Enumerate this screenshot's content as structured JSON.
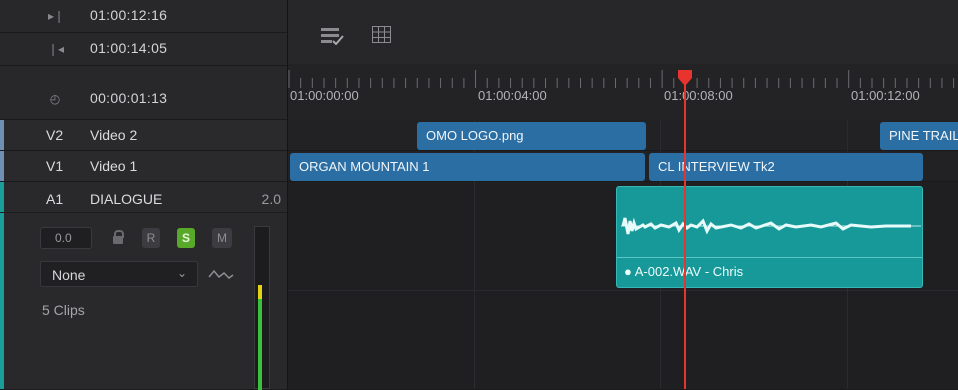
{
  "header": {
    "timecodes": [
      {
        "icon": "next-frame-icon",
        "glyph": "▸❘",
        "value": "01:00:12:16"
      },
      {
        "icon": "prev-frame-icon",
        "glyph": "❘◂",
        "value": "01:00:14:05"
      },
      {
        "icon": "clock-icon",
        "glyph": "◴",
        "value": "00:00:01:13"
      }
    ]
  },
  "tracks": {
    "v2": {
      "id": "V2",
      "name": "Video 2"
    },
    "v1": {
      "id": "V1",
      "name": "Video 1"
    },
    "a1": {
      "id": "A1",
      "name": "DIALOGUE",
      "channels": "2.0",
      "volume": "0.0",
      "record": "R",
      "solo": "S",
      "mute": "M",
      "effect": "None",
      "clips_count": "5 Clips"
    }
  },
  "ruler": {
    "labels": [
      "01:00:00:00",
      "01:00:04:00",
      "01:00:08:00",
      "01:00:12:00"
    ]
  },
  "clips": {
    "omo_logo": "OMO LOGO.png",
    "pine_trail": "PINE TRAIL",
    "organ_mountain": "ORGAN MOUNTAIN 1",
    "cl_interview": "CL INTERVIEW Tk2",
    "audio": "● A-002.WAV - Chris"
  },
  "colors": {
    "video_clip": "#2b6ea3",
    "audio_clip": "#17999a",
    "playhead": "#e8332e"
  }
}
